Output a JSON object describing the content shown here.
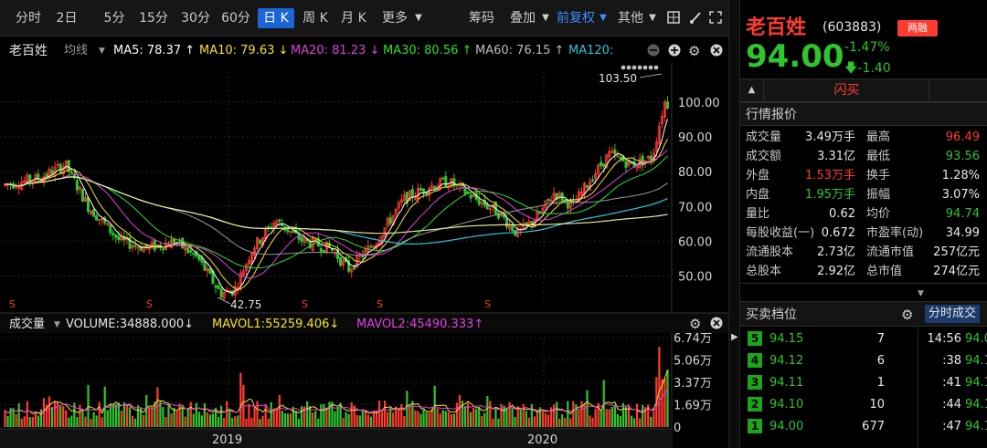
{
  "toolbar": {
    "tabs": [
      "分时",
      "2日",
      "5分",
      "15分",
      "30分",
      "60分",
      "日 K",
      "周 K",
      "月 K",
      "更多"
    ],
    "active_tab": "日 K",
    "right_buttons": [
      "筹码",
      "叠加",
      "前复权",
      "其他"
    ]
  },
  "chart": {
    "stock_name": "老百姓",
    "ma_mode": "均线",
    "ma": [
      {
        "label": "MA5: 78.37 ↑",
        "color": "#ffffff"
      },
      {
        "label": "MA10: 79.63 ↓",
        "color": "#f5e12c"
      },
      {
        "label": "MA20: 81.23 ↓",
        "color": "#e040e0"
      },
      {
        "label": "MA30: 80.56 ↑",
        "color": "#2ee02e"
      },
      {
        "label": "MA60: 76.15 ↑",
        "color": "#bdbdbd"
      },
      {
        "label": "MA120:",
        "color": "#2fc6e0"
      }
    ],
    "price_ticks": [
      "100.00",
      "90.00",
      "80.00",
      "70.00",
      "60.00",
      "50.00"
    ],
    "high_label": "103.50",
    "low_label": "42.75",
    "s_marker": "S",
    "volume": {
      "title": "成交量",
      "vol_label": "VOLUME:34888.000↓",
      "mavol1": "MAVOL1:55259.406↓",
      "mavol2": "MAVOL2:45490.333↑",
      "ticks": [
        "6.74万",
        "5.06万",
        "3.37万",
        "1.69万",
        "0"
      ]
    },
    "x_labels": [
      "2019",
      "2020"
    ],
    "colors": {
      "up": "#ff3b30",
      "down": "#2ec52e",
      "ma120": "#2fc6e0",
      "ma250": "#e8e890"
    }
  },
  "quote": {
    "name": "老百姓",
    "code": "(603883)",
    "badge": "两融",
    "price": "94.00",
    "pct": "-1.47%",
    "chg": "-1.40",
    "flash_buy": "闪买",
    "section_title": "行情报价",
    "rows": [
      [
        {
          "l": "成交量",
          "v": "3.49万手",
          "c": "white"
        },
        {
          "l": "最高",
          "v": "96.49",
          "c": "red"
        }
      ],
      [
        {
          "l": "成交额",
          "v": "3.31亿",
          "c": "white"
        },
        {
          "l": "最低",
          "v": "93.56",
          "c": "green"
        }
      ],
      [
        {
          "l": "外盘",
          "v": "1.53万手",
          "c": "red"
        },
        {
          "l": "换手",
          "v": "1.28%",
          "c": "white"
        }
      ],
      [
        {
          "l": "内盘",
          "v": "1.95万手",
          "c": "green"
        },
        {
          "l": "振幅",
          "v": "3.07%",
          "c": "white"
        }
      ],
      [
        {
          "l": "量比",
          "v": "0.62",
          "c": "white"
        },
        {
          "l": "均价",
          "v": "94.74",
          "c": "green"
        }
      ],
      [
        {
          "l": "每股收益(一)",
          "v": "0.672",
          "c": "white"
        },
        {
          "l": "市盈率(动)",
          "v": "34.99",
          "c": "white"
        }
      ],
      [
        {
          "l": "流通股本",
          "v": "2.73亿",
          "c": "white"
        },
        {
          "l": "流通市值",
          "v": "257亿元",
          "c": "white"
        }
      ],
      [
        {
          "l": "总股本",
          "v": "2.92亿",
          "c": "white"
        },
        {
          "l": "总市值",
          "v": "274亿元",
          "c": "white"
        }
      ]
    ]
  },
  "orderbook": {
    "title": "买卖档位",
    "tab": "分时成交",
    "levels": [
      {
        "n": "5",
        "price": "94.15",
        "vol": "7"
      },
      {
        "n": "4",
        "price": "94.12",
        "vol": "6"
      },
      {
        "n": "3",
        "price": "94.11",
        "vol": "1"
      },
      {
        "n": "2",
        "price": "94.10",
        "vol": "10"
      },
      {
        "n": "1",
        "price": "94.00",
        "vol": "677"
      }
    ],
    "ticks": [
      {
        "t": "14:56",
        "p": "94.0"
      },
      {
        "t": ":38",
        "p": "94.1"
      },
      {
        "t": ":41",
        "p": "94.1"
      },
      {
        "t": ":44",
        "p": "94.1"
      },
      {
        "t": ":47",
        "p": "94.1"
      }
    ]
  }
}
